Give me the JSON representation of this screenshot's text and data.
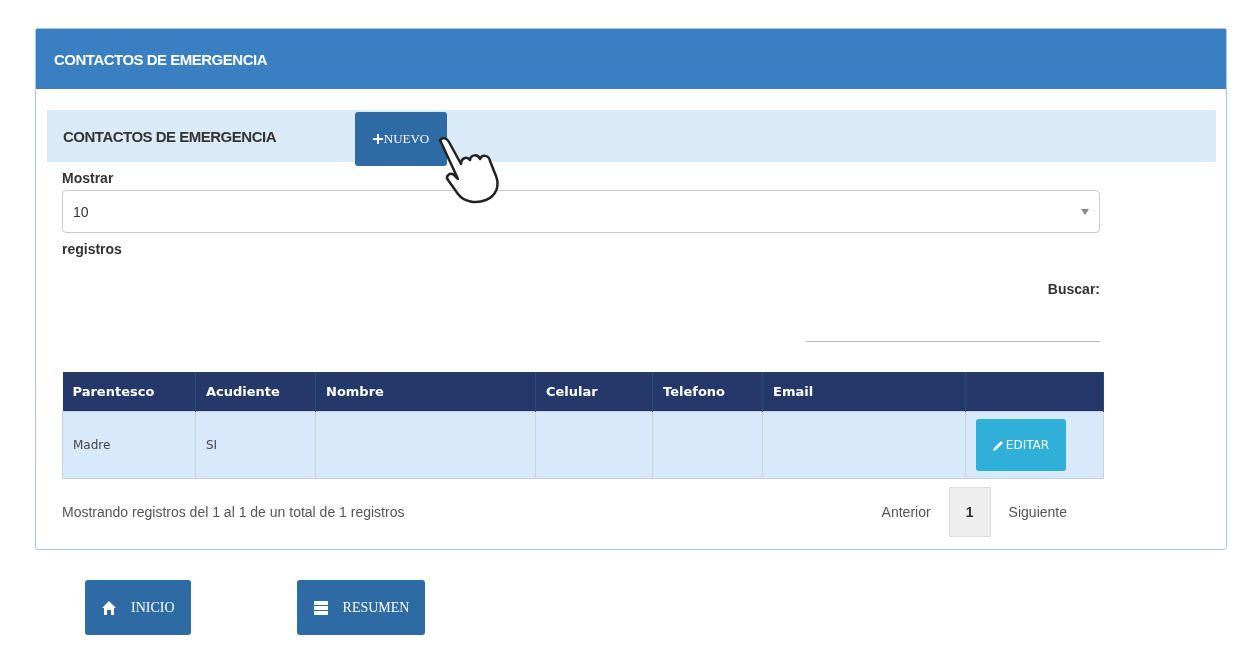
{
  "panel": {
    "title": "CONTACTOS DE EMERGENCIA"
  },
  "section": {
    "title": "CONTACTOS DE EMERGENCIA",
    "new_button": "NUEVO"
  },
  "length": {
    "label": "Mostrar",
    "value": "10",
    "suffix": "registros"
  },
  "search": {
    "label": "Buscar:"
  },
  "table": {
    "columns": [
      "Parentesco",
      "Acudiente",
      "Nombre",
      "Celular",
      "Telefono",
      "Email",
      ""
    ],
    "rows": [
      {
        "cells": [
          "Madre",
          "SI",
          "",
          "",
          "",
          ""
        ],
        "action": "EDITAR"
      }
    ]
  },
  "info": "Mostrando registros del 1 al 1 de un total de 1 registros",
  "pagination": {
    "previous": "Anterior",
    "pages": [
      {
        "label": "1",
        "selected": true
      }
    ],
    "next": "Siguiente"
  },
  "nav_buttons": [
    {
      "kind": "home",
      "label": "INICIO"
    },
    {
      "kind": "list",
      "label": "RESUMEN"
    }
  ]
}
